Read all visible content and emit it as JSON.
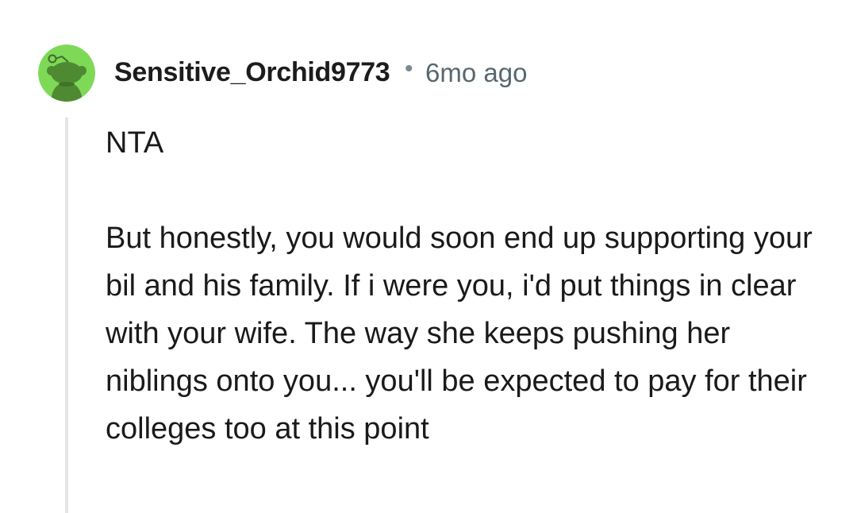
{
  "comment": {
    "username": "Sensitive_Orchid9773",
    "separator": "•",
    "timestamp": "6mo ago",
    "avatar_icon": "reddit-snoo-avatar",
    "avatar_bg_color": "#7ed957",
    "body": {
      "paragraph_1": "NTA",
      "paragraph_2": "But honestly, you would soon end up supporting your bil and his family. If i were you, i'd put things in clear with your wife. The way she keeps pushing her niblings onto you... you'll be expected to pay for their colleges too at this point"
    }
  }
}
